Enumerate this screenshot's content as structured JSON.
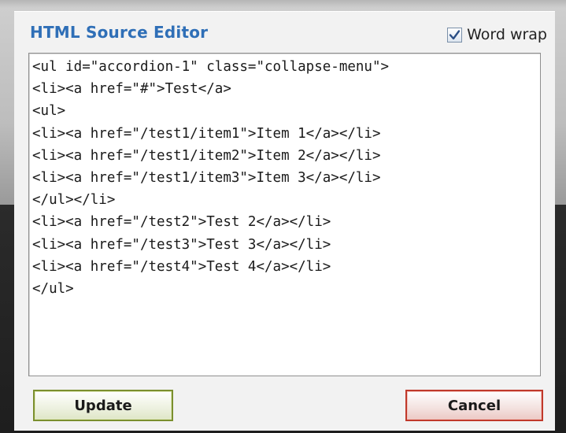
{
  "dialog": {
    "title": "HTML Source Editor",
    "word_wrap": {
      "label": "Word wrap",
      "checked": true
    }
  },
  "editor": {
    "lines": [
      "<ul id=\"accordion-1\" class=\"collapse-menu\">",
      "<li><a href=\"#\">Test</a>",
      "<ul>",
      "<li><a href=\"/test1/item1\">Item 1</a></li>",
      "<li><a href=\"/test1/item2\">Item 2</a></li>",
      "<li><a href=\"/test1/item3\">Item 3</a></li>",
      "</ul></li>",
      "<li><a href=\"/test2\">Test 2</a></li>",
      "<li><a href=\"/test3\">Test 3</a></li>",
      "<li><a href=\"/test4\">Test 4</a></li>",
      "</ul>"
    ]
  },
  "buttons": {
    "update": "Update",
    "cancel": "Cancel"
  },
  "colors": {
    "title": "#2f6fb7",
    "update_border": "#7b8f2e",
    "cancel_border": "#c0392b"
  },
  "icons": {
    "checkbox_mark": "checkmark-icon"
  }
}
